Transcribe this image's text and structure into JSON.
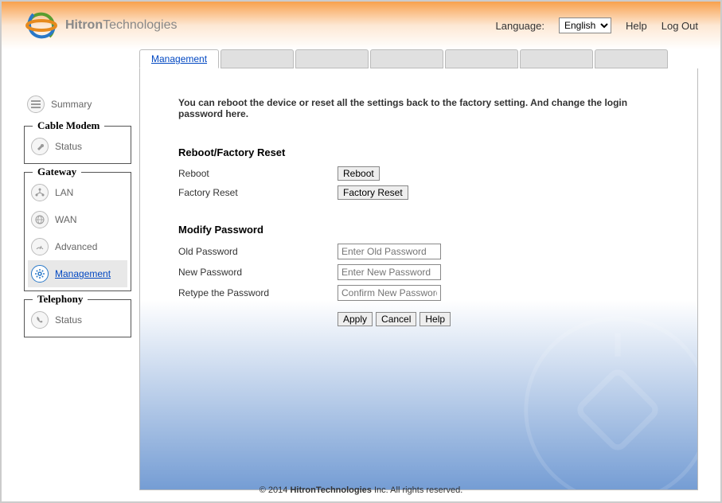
{
  "header": {
    "brand_bold": "Hitron",
    "brand_normal": "Technologies",
    "language_label": "Language:",
    "language_value": "English",
    "help": "Help",
    "logout": "Log Out"
  },
  "sidebar": {
    "summary": "Summary",
    "group_cable": "Cable Modem",
    "cable_status": "Status",
    "group_gateway": "Gateway",
    "gw_lan": "LAN",
    "gw_wan": "WAN",
    "gw_adv": "Advanced",
    "gw_mgmt": "Management",
    "group_telephony": "Telephony",
    "tel_status": "Status"
  },
  "tabs": {
    "management": "Management"
  },
  "panel": {
    "desc": "You can reboot the device or reset all the settings back to the factory setting. And change the login password here.",
    "sec1_title": "Reboot/Factory Reset",
    "reboot_label": "Reboot",
    "reboot_btn": "Reboot",
    "factory_label": "Factory Reset",
    "factory_btn": "Factory Reset",
    "sec2_title": "Modify Password",
    "old_pw_label": "Old Password",
    "old_pw_ph": "Enter Old Password",
    "new_pw_label": "New Password",
    "new_pw_ph": "Enter New Password",
    "retype_label": "Retype the Password",
    "retype_ph": "Confirm New Password",
    "apply": "Apply",
    "cancel": "Cancel",
    "help": "Help"
  },
  "footer": {
    "copy": "© 2014 ",
    "brand_bold": "Hitron",
    "brand_normal": "Technologies",
    "rest": " Inc.  All rights reserved."
  }
}
